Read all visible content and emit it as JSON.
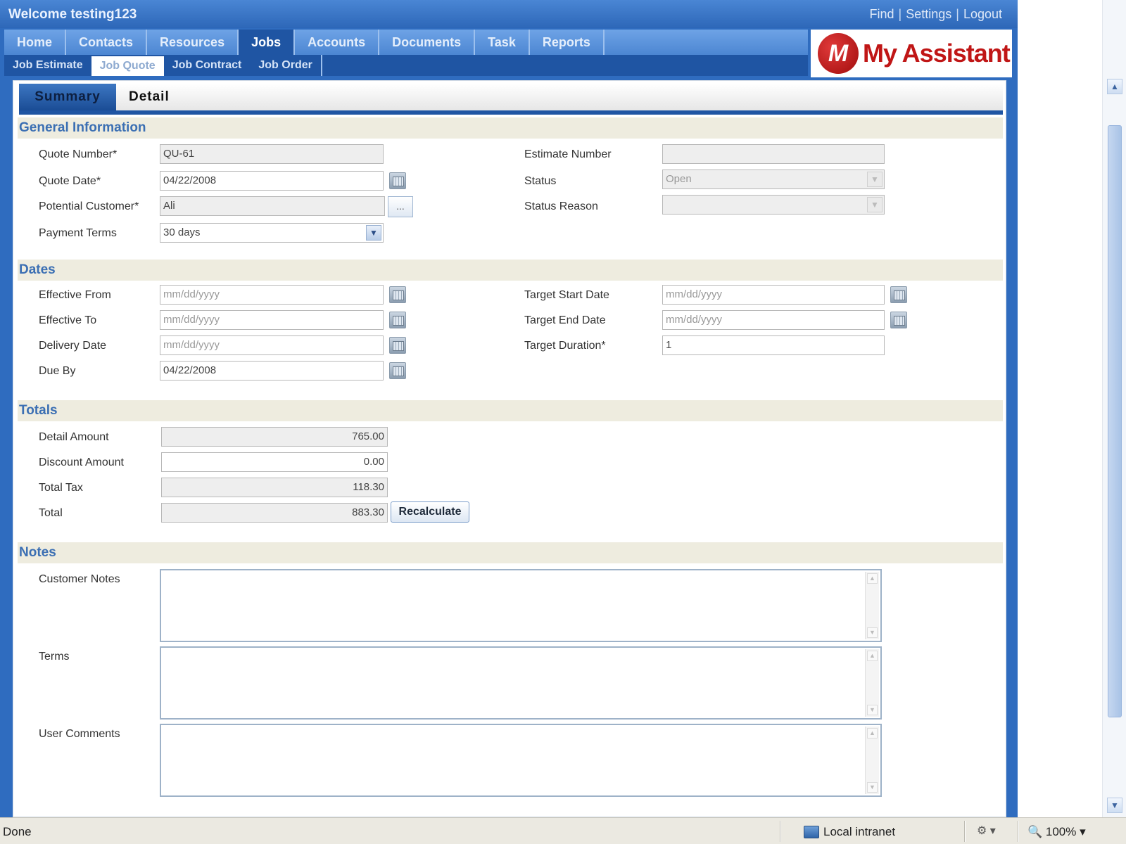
{
  "welcome": "Welcome testing123",
  "top_links": [
    "Find",
    "Settings",
    "Logout"
  ],
  "main_nav": [
    "Home",
    "Contacts",
    "Resources",
    "Jobs",
    "Accounts",
    "Documents",
    "Task",
    "Reports"
  ],
  "sub_nav": [
    "Job Estimate",
    "Job Quote",
    "Job Contract",
    "Job Order"
  ],
  "logo": {
    "mark": "M",
    "text": "My Assistant"
  },
  "form_tabs": [
    "Summary",
    "Detail"
  ],
  "sections": {
    "general": "General Information",
    "dates": "Dates",
    "totals": "Totals",
    "notes": "Notes"
  },
  "general": {
    "quote_number": {
      "label": "Quote Number*",
      "value": "QU-61"
    },
    "quote_date": {
      "label": "Quote Date*",
      "value": "04/22/2008"
    },
    "potential_customer": {
      "label": "Potential Customer*",
      "value": "Ali",
      "button": "..."
    },
    "payment_terms": {
      "label": "Payment Terms",
      "value": "30 days"
    },
    "estimate_number": {
      "label": "Estimate Number",
      "value": ""
    },
    "status": {
      "label": "Status",
      "value": "Open"
    },
    "status_reason": {
      "label": "Status Reason",
      "value": ""
    }
  },
  "dates": {
    "effective_from": {
      "label": "Effective From",
      "placeholder": "mm/dd/yyyy"
    },
    "effective_to": {
      "label": "Effective To",
      "placeholder": "mm/dd/yyyy"
    },
    "delivery_date": {
      "label": "Delivery Date",
      "placeholder": "mm/dd/yyyy"
    },
    "due_by": {
      "label": "Due By",
      "value": "04/22/2008"
    },
    "target_start": {
      "label": "Target Start Date",
      "placeholder": "mm/dd/yyyy"
    },
    "target_end": {
      "label": "Target End Date",
      "placeholder": "mm/dd/yyyy"
    },
    "target_duration": {
      "label": "Target Duration*",
      "value": "1"
    }
  },
  "totals": {
    "detail_amount": {
      "label": "Detail Amount",
      "value": "765.00"
    },
    "discount_amount": {
      "label": "Discount Amount",
      "value": "0.00"
    },
    "total_tax": {
      "label": "Total Tax",
      "value": "118.30"
    },
    "total": {
      "label": "Total",
      "value": "883.30"
    },
    "recalculate": "Recalculate"
  },
  "notes": {
    "customer_notes": "Customer Notes",
    "terms": "Terms",
    "user_comments": "User Comments"
  },
  "statusbar": {
    "status": "Done",
    "zone": "Local intranet",
    "zoom": "100%"
  },
  "colors": {
    "brand_blue": "#2f6cbf",
    "nav_dark": "#1f55a3",
    "section_bg": "#eeecdf",
    "section_text": "#3b6fb3",
    "logo_red": "#c01616"
  }
}
